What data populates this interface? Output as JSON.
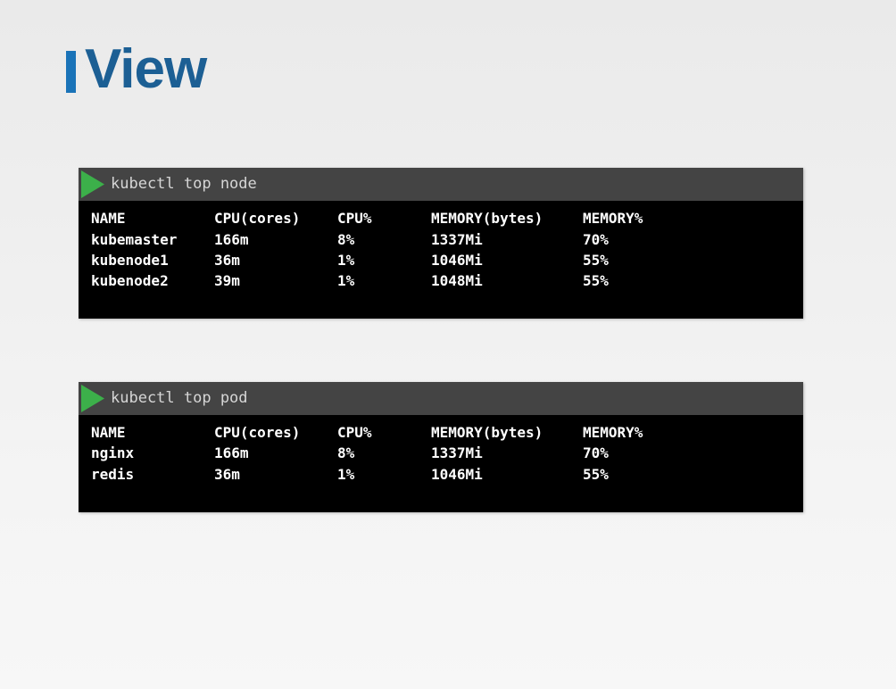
{
  "slide": {
    "title": "View",
    "accent_color": "#1a73b8",
    "title_color": "#1c5f94"
  },
  "terminals": {
    "node": {
      "prompt_icon": "green-play-triangle",
      "command": "kubectl top node",
      "headers": [
        "NAME",
        "CPU(cores)",
        "CPU%",
        "MEMORY(bytes)",
        "MEMORY%"
      ],
      "rows": [
        [
          "kubemaster",
          "166m",
          "8%",
          "1337Mi",
          "70%"
        ],
        [
          "kubenode1",
          "36m",
          "1%",
          "1046Mi",
          "55%"
        ],
        [
          "kubenode2",
          "39m",
          "1%",
          "1048Mi",
          "55%"
        ]
      ]
    },
    "pod": {
      "prompt_icon": "green-play-triangle",
      "command": "kubectl top pod",
      "headers": [
        "NAME",
        "CPU(cores)",
        "CPU%",
        "MEMORY(bytes)",
        "MEMORY%"
      ],
      "rows": [
        [
          "nginx",
          "166m",
          "8%",
          "1337Mi",
          "70%"
        ],
        [
          "redis",
          "36m",
          "1%",
          "1046Mi",
          "55%"
        ]
      ]
    }
  },
  "colors": {
    "terminal_header": "#444444",
    "terminal_body": "#000000",
    "prompt_green": "#3cb04a"
  }
}
